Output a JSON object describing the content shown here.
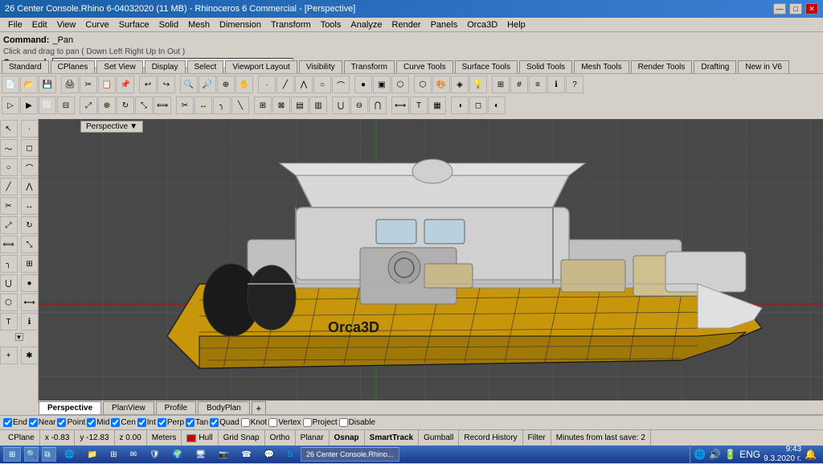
{
  "title_bar": {
    "title": "26 Center Console.Rhino 6-04032020 (11 MB) - Rhinoceros 6 Commercial - [Perspective]",
    "minimize": "—",
    "maximize": "□",
    "close": "✕"
  },
  "menu": {
    "items": [
      "File",
      "Edit",
      "View",
      "Curve",
      "Surface",
      "Solid",
      "Mesh",
      "Dimension",
      "Transform",
      "Tools",
      "Analyze",
      "Render",
      "Panels",
      "Orca3D",
      "Help"
    ]
  },
  "command": {
    "label": "Command:",
    "value": "_Pan",
    "hint": "Click and drag to pan ( Down Left Right Up In Out )",
    "prompt_label": "Command:",
    "prompt_value": ""
  },
  "toolbar_tabs": [
    "Standard",
    "CPlanes",
    "Set View",
    "Display",
    "Select",
    "Viewport Layout",
    "Visibility",
    "Transform",
    "Curve Tools",
    "Surface Tools",
    "Solid Tools",
    "Mesh Tools",
    "Render Tools",
    "Drafting",
    "New in V6"
  ],
  "viewport": {
    "label": "Perspective",
    "grid_color": "#555",
    "background": "#444"
  },
  "view_tabs": [
    "Perspective",
    "PlanView",
    "Profile",
    "BodyPlan"
  ],
  "view_tabs_active": "Perspective",
  "snap_options": [
    {
      "id": "end",
      "label": "End",
      "checked": true
    },
    {
      "id": "near",
      "label": "Near",
      "checked": true
    },
    {
      "id": "point",
      "label": "Point",
      "checked": true
    },
    {
      "id": "mid",
      "label": "Mid",
      "checked": true
    },
    {
      "id": "cen",
      "label": "Cen",
      "checked": true
    },
    {
      "id": "int",
      "label": "Int",
      "checked": true
    },
    {
      "id": "perp",
      "label": "Perp",
      "checked": true
    },
    {
      "id": "tan",
      "label": "Tan",
      "checked": true
    },
    {
      "id": "quad",
      "label": "Quad",
      "checked": true
    },
    {
      "id": "knot",
      "label": "Knot",
      "checked": false
    },
    {
      "id": "vertex",
      "label": "Vertex",
      "checked": false
    },
    {
      "id": "project",
      "label": "Project",
      "checked": false
    },
    {
      "id": "disable",
      "label": "Disable",
      "checked": false
    }
  ],
  "status_bar": {
    "cplane": "CPlane",
    "x": "x -0.83",
    "y": "y -12.83",
    "z": "z 0.00",
    "units": "Meters",
    "layer": "Hull",
    "grid_snap": "Grid Snap",
    "ortho": "Ortho",
    "planar": "Planar",
    "osnap": "Osnap",
    "smarttrack": "SmartTrack",
    "gumball": "Gumball",
    "record_history": "Record History",
    "filter": "Filter",
    "last_save": "Minutes from last save: 2"
  },
  "taskbar": {
    "start_label": "⊞",
    "apps": [
      "🌐",
      "📁",
      "⊞",
      "📋",
      "🛡",
      "🦊",
      "🖥",
      "📷",
      "☎",
      "📞",
      "S",
      "🎭"
    ],
    "rhino_label": "26 Center Console.Rhino...",
    "time": "9:43",
    "date": "9.3.2020 г."
  }
}
